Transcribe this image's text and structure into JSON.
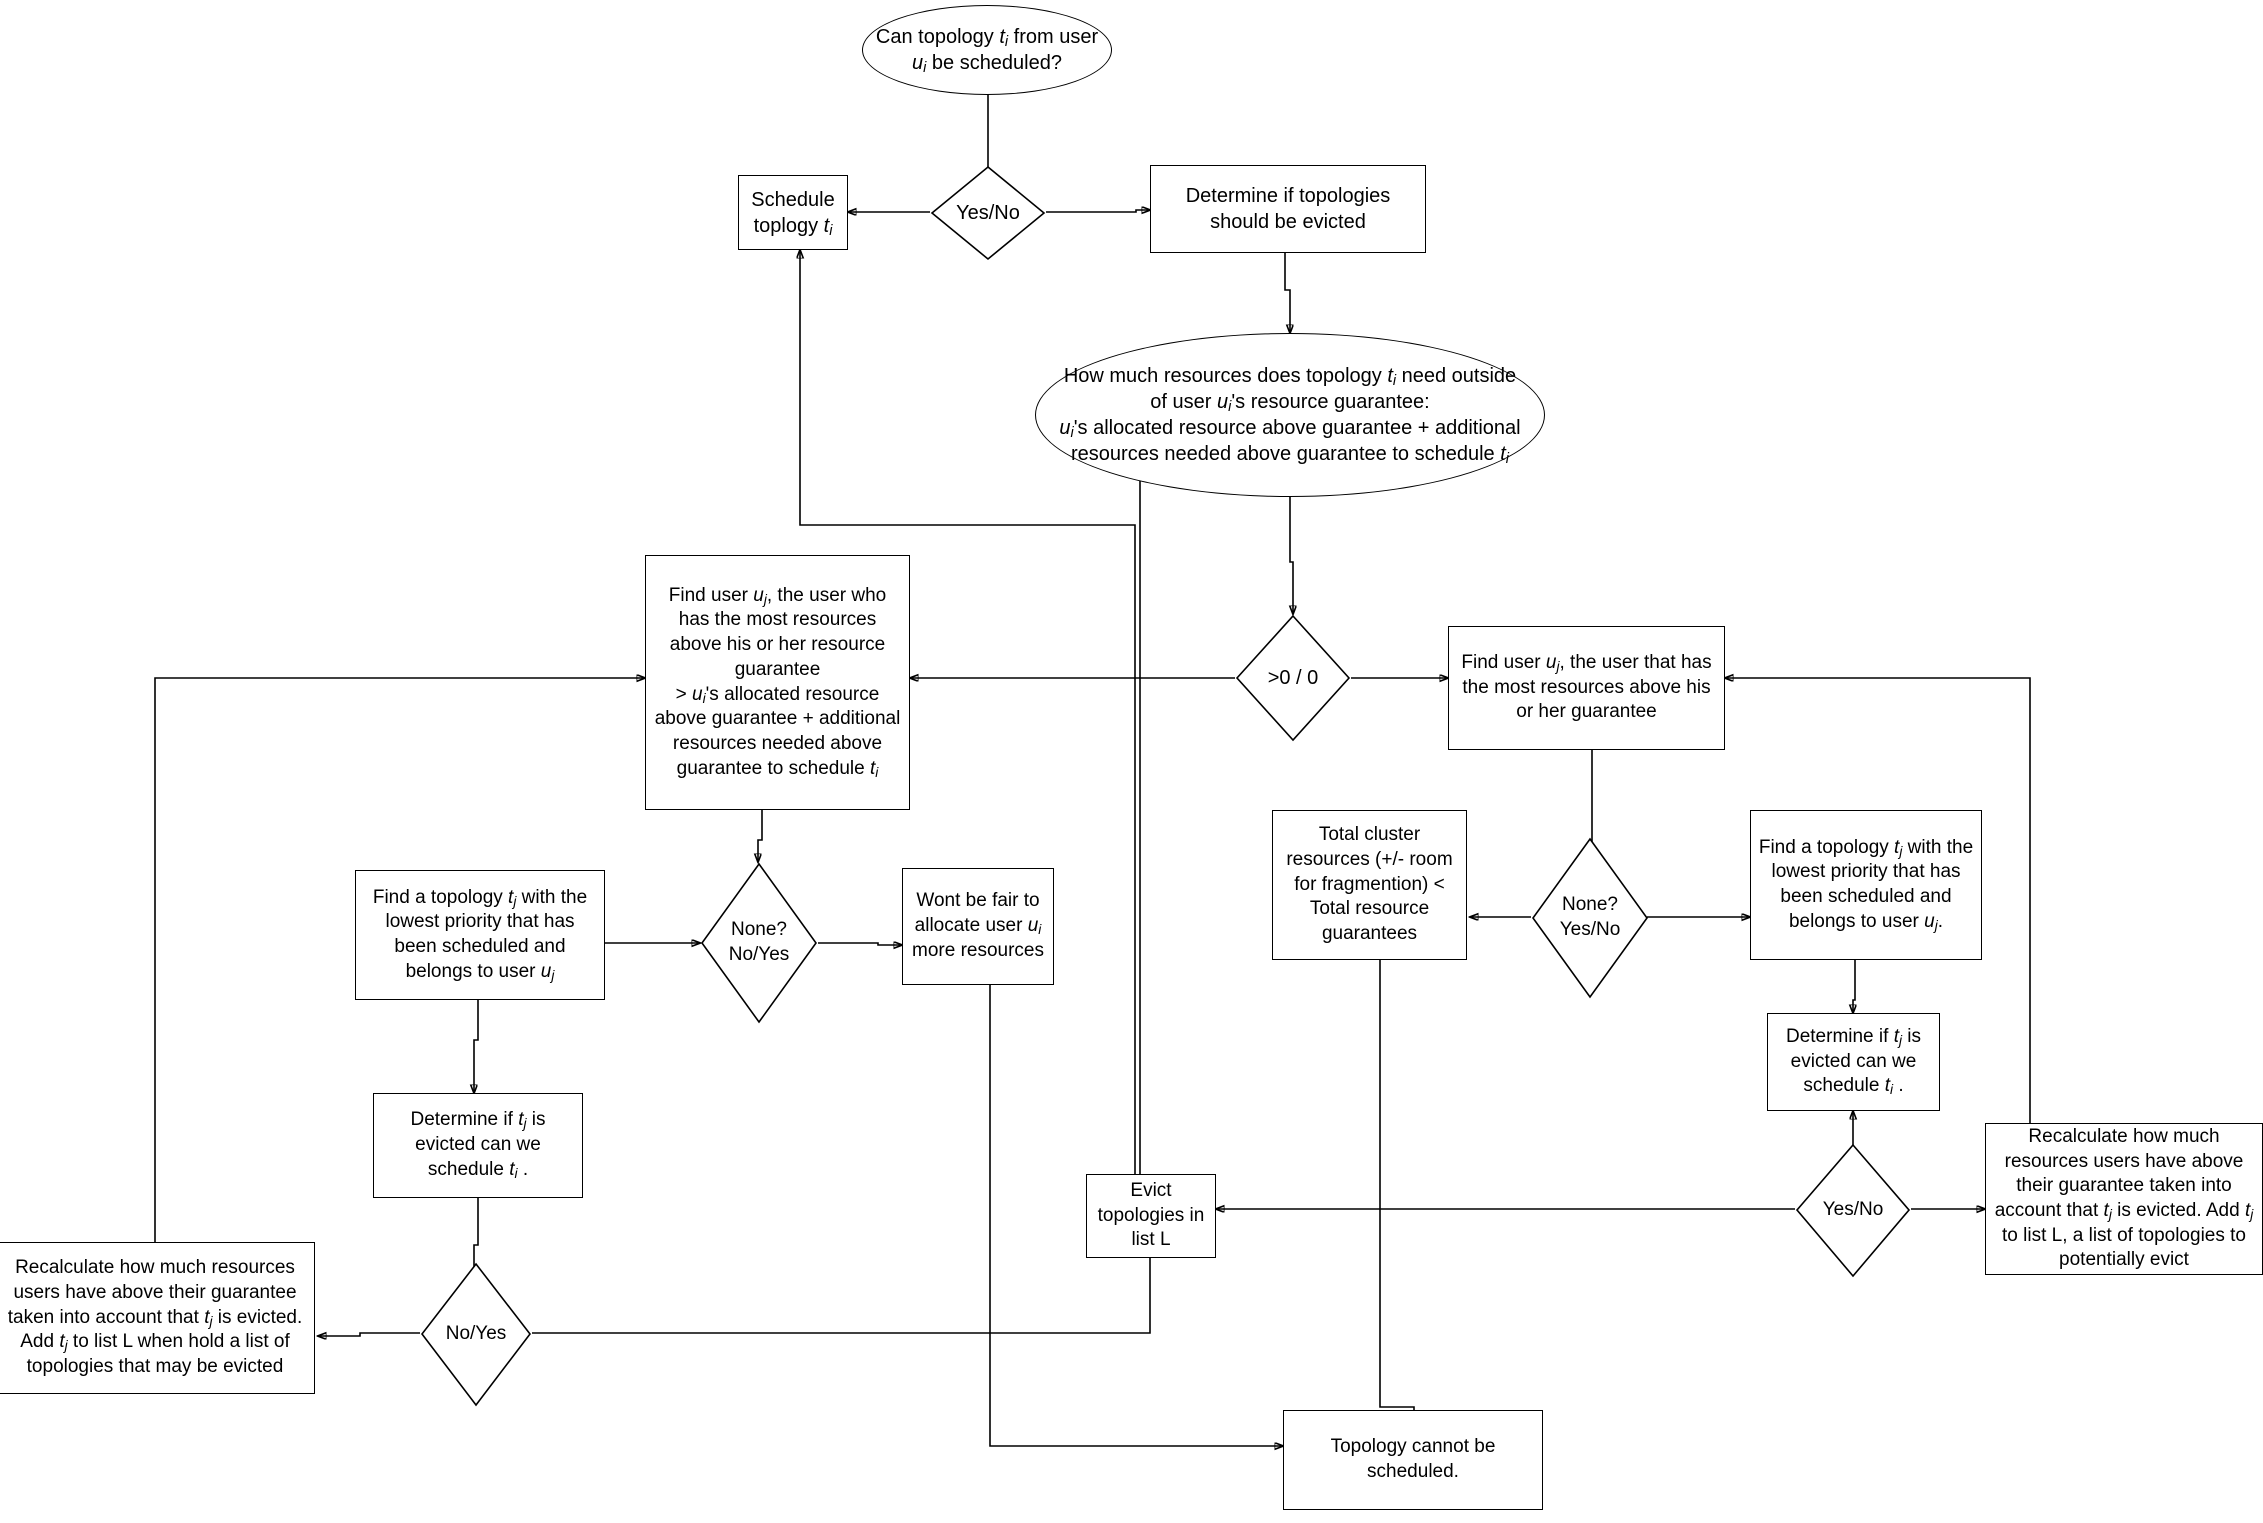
{
  "diagram": {
    "title": "Topology scheduling and eviction decision flowchart",
    "stroke_color": "#000000",
    "background_color": "#ffffff",
    "nodes": {
      "start_question": "Can topology t_i from user u_i be scheduled?",
      "decision_yes_no_top": "Yes/No",
      "schedule_topology": "Schedule toplogy t_i",
      "determine_evicted": "Determine if topologies should be evicted",
      "how_much_resources": "How much resources does topology t_i need outside of user u_i's resource guarantee:\nu_i's allocated resource above guarantee + additional resources needed above guarantee to schedule t_i",
      "decision_gt0": ">0 / 0",
      "find_user_left": "Find user u_j, the user who has the most  resources above his or her resource guarantee\n> u_i's allocated resource above guarantee + additional resources needed above guarantee to schedule t_i",
      "find_user_right": "Find user u_j, the user that has the most resources above his or her guarantee",
      "find_topology_left": "Find a topology t_j with the lowest priority that has been scheduled and belongs to user u_j",
      "decision_none_no_yes": "None?\nNo/Yes",
      "wont_be_fair": "Wont be fair to allocate user u_i more resources",
      "total_cluster": "Total cluster resources (+/- room for fragmention) < Total resource guarantees",
      "decision_none_yes_no": "None?\nYes/No",
      "find_topology_right": "Find a topology t_j with the lowest priority that has been scheduled and belongs to user u_j.",
      "determine_evict_left": "Determine if t_j is evicted can we schedule t_i .",
      "determine_evict_right": "Determine if t_j is evicted can we schedule t_i .",
      "decision_no_yes": "No/Yes",
      "decision_yes_no_bottom": "Yes/No",
      "recalculate_left": "Recalculate how much resources users have above their guarantee taken into account that t_j is evicted. Add t_j to list L when hold a list of topologies that may be evicted",
      "recalculate_right": "Recalculate how much resources users have above their guarantee taken into account that t_j is evicted. Add t_j to list L, a list of topologies to potentially evict",
      "evict_topologies": "Evict topologies in list L",
      "topology_cannot": "Topology cannot be scheduled."
    }
  }
}
